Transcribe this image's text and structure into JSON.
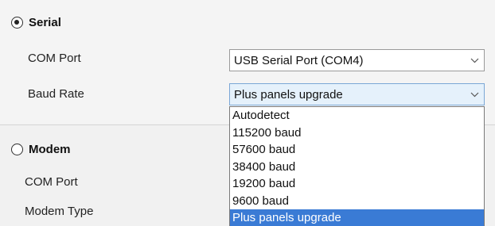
{
  "serial": {
    "radio_label": "Serial",
    "selected": true,
    "com_port_label": "COM Port",
    "com_port_value": "USB Serial Port (COM4)",
    "baud_rate_label": "Baud Rate",
    "baud_rate_value": "Plus panels upgrade"
  },
  "baud_rate_dropdown": {
    "options": [
      "Autodetect",
      "115200 baud",
      "57600 baud",
      "38400 baud",
      "19200 baud",
      "9600 baud",
      "Plus panels upgrade"
    ],
    "selected_option": "Plus panels upgrade"
  },
  "modem": {
    "radio_label": "Modem",
    "selected": false,
    "com_port_label": "COM Port",
    "modem_type_label": "Modem Type"
  },
  "icons": {
    "combo_arrow": "chevron-down-icon"
  },
  "colors": {
    "selection_highlight": "#3a7bd5",
    "active_combo_background": "#e5f1fb"
  }
}
